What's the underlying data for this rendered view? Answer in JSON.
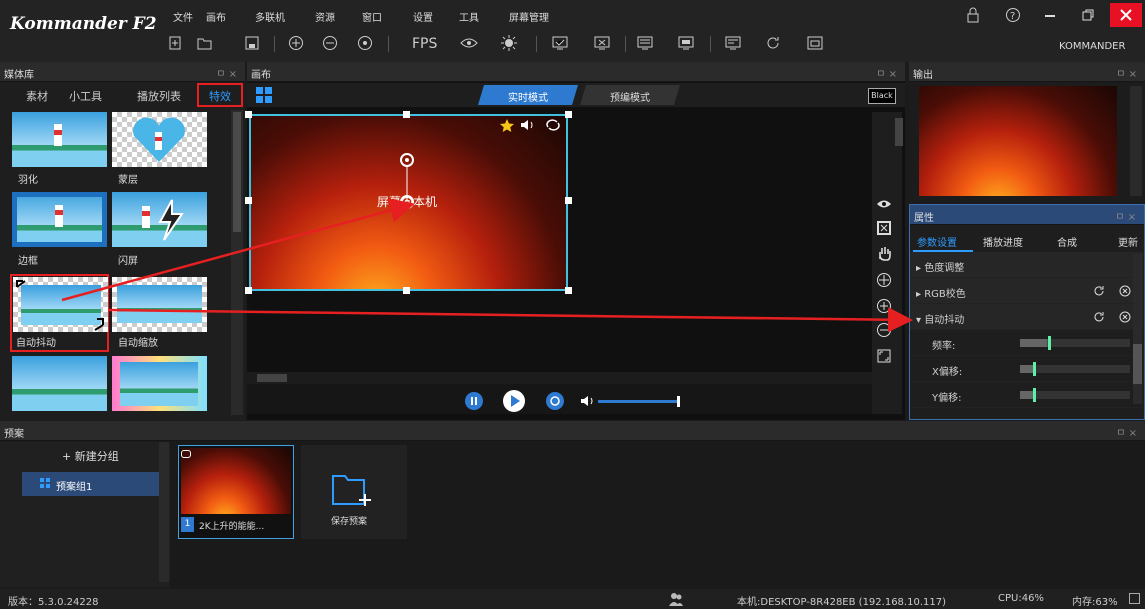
{
  "app": {
    "logo": "Kommander F2",
    "user": "KOMMANDER"
  },
  "menu": [
    "文件",
    "画布",
    "多联机",
    "资源",
    "窗口",
    "设置",
    "工具",
    "屏幕管理"
  ],
  "toolbar": {
    "fps_label": "FPS"
  },
  "media_library": {
    "title": "媒体库",
    "close": "ㅁ ×",
    "tabs": [
      "素材",
      "小工具",
      "播放列表",
      "特效"
    ],
    "effects": [
      "羽化",
      "蒙层",
      "边框",
      "闪屏",
      "自动抖动",
      "自动缩放"
    ]
  },
  "canvas": {
    "title": "画布",
    "close": "ㅁ ×",
    "mode_realtime": "实时模式",
    "mode_preedit": "预编模式",
    "black_badge": "Black",
    "layer_text": "屏幕@本机"
  },
  "output": {
    "title": "输出",
    "close": "ㅁ ×"
  },
  "properties": {
    "title": "属性",
    "close": "ㅁ ×",
    "tabs": [
      "参数设置",
      "播放进度",
      "合成",
      "更新"
    ],
    "sections": [
      "▸ 色度调整",
      "▸ RGB校色",
      "▾ 自动抖动"
    ],
    "params": [
      {
        "label": "频率:",
        "value": 0.25
      },
      {
        "label": "X偏移:",
        "value": 0.12
      },
      {
        "label": "Y偏移:",
        "value": 0.12
      }
    ]
  },
  "preset": {
    "title": "预案",
    "close": "ㅁ ×",
    "new_group": "+ 新建分组",
    "group": "预案组1",
    "item_index": "1",
    "item_label": "2K上升的能能...",
    "save_label": "保存预案"
  },
  "status": {
    "version": "版本：5.3.0.24228",
    "host": "本机:DESKTOP-8R428EB (192.168.10.117)",
    "cpu": "CPU:46%",
    "memory": "内存:63%"
  },
  "colors": {
    "accent": "#2e7ad0",
    "highlight": "#e62020",
    "selection": "#41c0e0"
  }
}
